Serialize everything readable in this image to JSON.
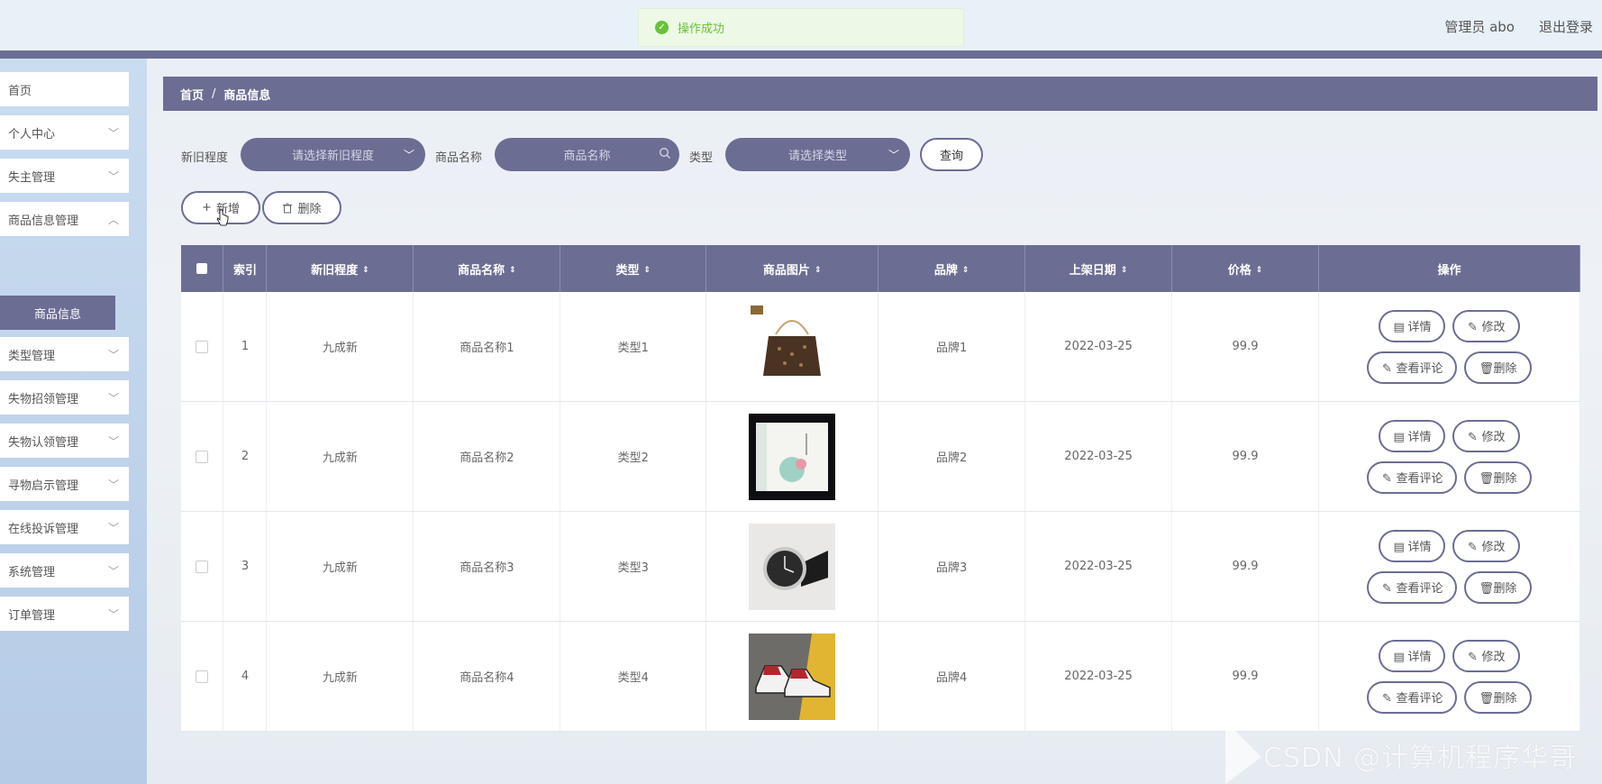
{
  "toast": {
    "text": "操作成功"
  },
  "header": {
    "user": "管理员 abo",
    "logout": "退出登录"
  },
  "sidebar": {
    "items": [
      {
        "label": "首页",
        "has_children": false
      },
      {
        "label": "个人中心",
        "has_children": true
      },
      {
        "label": "失主管理",
        "has_children": true
      },
      {
        "label": "商品信息管理",
        "has_children": true
      },
      {
        "label": "类型管理",
        "has_children": true
      },
      {
        "label": "失物招领管理",
        "has_children": true
      },
      {
        "label": "失物认领管理",
        "has_children": true
      },
      {
        "label": "寻物启示管理",
        "has_children": true
      },
      {
        "label": "在线投诉管理",
        "has_children": true
      },
      {
        "label": "系统管理",
        "has_children": true
      },
      {
        "label": "订单管理",
        "has_children": true
      }
    ],
    "active_sub": "商品信息"
  },
  "breadcrumb": {
    "home": "首页",
    "separator": "/",
    "current": "商品信息"
  },
  "filters": {
    "condition_label": "新旧程度",
    "condition_placeholder": "请选择新旧程度",
    "name_label": "商品名称",
    "name_placeholder": "商品名称",
    "type_label": "类型",
    "type_placeholder": "请选择类型",
    "query_button": "查询"
  },
  "actions": {
    "add": "新增",
    "delete": "删除"
  },
  "table": {
    "headers": {
      "index": "索引",
      "condition": "新旧程度",
      "name": "商品名称",
      "type": "类型",
      "image": "商品图片",
      "brand": "品牌",
      "date": "上架日期",
      "price": "价格",
      "ops": "操作"
    },
    "rows": [
      {
        "index": "1",
        "condition": "九成新",
        "name": "商品名称1",
        "type": "类型1",
        "image": "handbag",
        "brand": "品牌1",
        "date": "2022-03-25",
        "price": "99.9"
      },
      {
        "index": "2",
        "condition": "九成新",
        "name": "商品名称2",
        "type": "类型2",
        "image": "book-box",
        "brand": "品牌2",
        "date": "2022-03-25",
        "price": "99.9"
      },
      {
        "index": "3",
        "condition": "九成新",
        "name": "商品名称3",
        "type": "类型3",
        "image": "watch",
        "brand": "品牌3",
        "date": "2022-03-25",
        "price": "99.9"
      },
      {
        "index": "4",
        "condition": "九成新",
        "name": "商品名称4",
        "type": "类型4",
        "image": "sneakers",
        "brand": "品牌4",
        "date": "2022-03-25",
        "price": "99.9"
      }
    ],
    "ops": {
      "detail": "详情",
      "edit": "修改",
      "comments": "查看评论",
      "delete": "删除"
    }
  },
  "watermark": "CSDN @计算机程序华哥",
  "colors": {
    "primary": "#6b6d93",
    "success": "#67c23a"
  }
}
